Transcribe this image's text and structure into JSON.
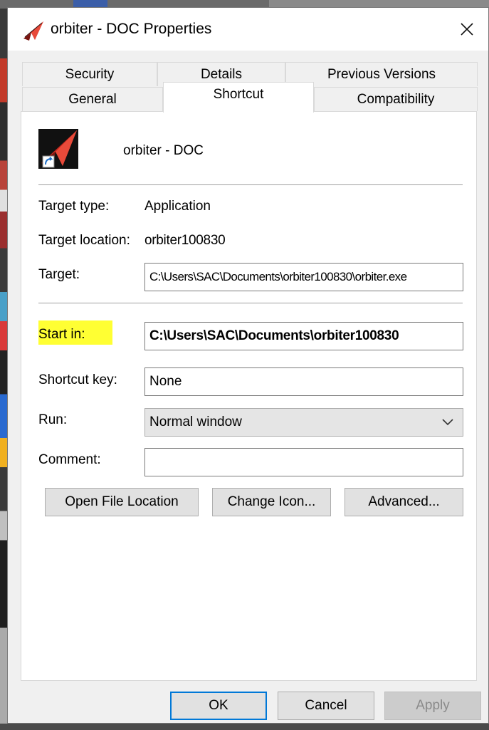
{
  "window": {
    "title": "orbiter - DOC Properties",
    "icon": "orbiter-app-icon"
  },
  "tabs": {
    "row_top": [
      "Security",
      "Details",
      "Previous Versions"
    ],
    "row_bottom": [
      "General",
      "Shortcut",
      "Compatibility"
    ],
    "active": "Shortcut"
  },
  "shortcut": {
    "name": "orbiter - DOC",
    "target_type_label": "Target type:",
    "target_type_value": "Application",
    "target_location_label": "Target location:",
    "target_location_value": "orbiter100830",
    "target_label": "Target:",
    "target_value": "C:\\Users\\SAC\\Documents\\orbiter100830\\orbiter.exe",
    "start_in_label": "Start in:",
    "start_in_value": "C:\\Users\\SAC\\Documents\\orbiter100830",
    "shortcut_key_label": "Shortcut key:",
    "shortcut_key_value": "None",
    "run_label": "Run:",
    "run_value": "Normal window",
    "comment_label": "Comment:",
    "comment_value": ""
  },
  "buttons": {
    "open_file_location": "Open File Location",
    "change_icon": "Change Icon...",
    "advanced": "Advanced...",
    "ok": "OK",
    "cancel": "Cancel",
    "apply": "Apply"
  },
  "colors": {
    "highlight": "#ffff33",
    "accent": "#0078d7",
    "icon_red": "#c0261c"
  }
}
